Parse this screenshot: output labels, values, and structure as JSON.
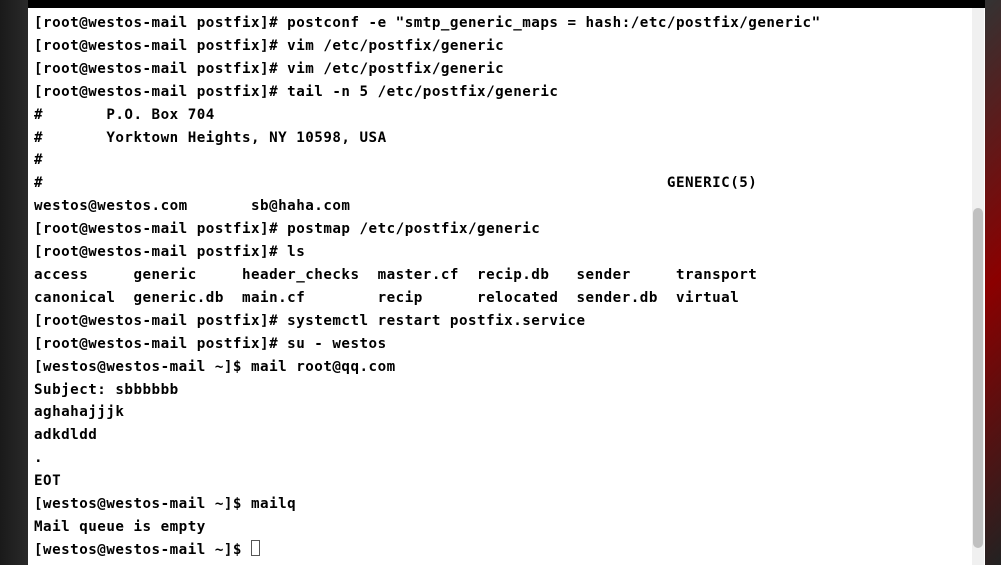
{
  "terminal": {
    "lines": [
      "[root@westos-mail postfix]# postconf -e \"smtp_generic_maps = hash:/etc/postfix/generic\"",
      "[root@westos-mail postfix]# vim /etc/postfix/generic",
      "[root@westos-mail postfix]# vim /etc/postfix/generic",
      "[root@westos-mail postfix]# tail -n 5 /etc/postfix/generic",
      "#       P.O. Box 704",
      "#       Yorktown Heights, NY 10598, USA",
      "#",
      "#                                                                     GENERIC(5)",
      "westos@westos.com       sb@haha.com",
      "[root@westos-mail postfix]# postmap /etc/postfix/generic",
      "[root@westos-mail postfix]# ls",
      "access     generic     header_checks  master.cf  recip.db   sender     transport",
      "canonical  generic.db  main.cf        recip      relocated  sender.db  virtual",
      "[root@westos-mail postfix]# systemctl restart postfix.service",
      "[root@westos-mail postfix]# su - westos",
      "[westos@westos-mail ~]$ mail root@qq.com",
      "Subject: sbbbbbb",
      "aghahajjjk",
      "adkdldd",
      ".",
      "EOT",
      "[westos@westos-mail ~]$ mailq",
      "Mail queue is empty"
    ],
    "cursor_line": "[westos@westos-mail ~]$ "
  }
}
